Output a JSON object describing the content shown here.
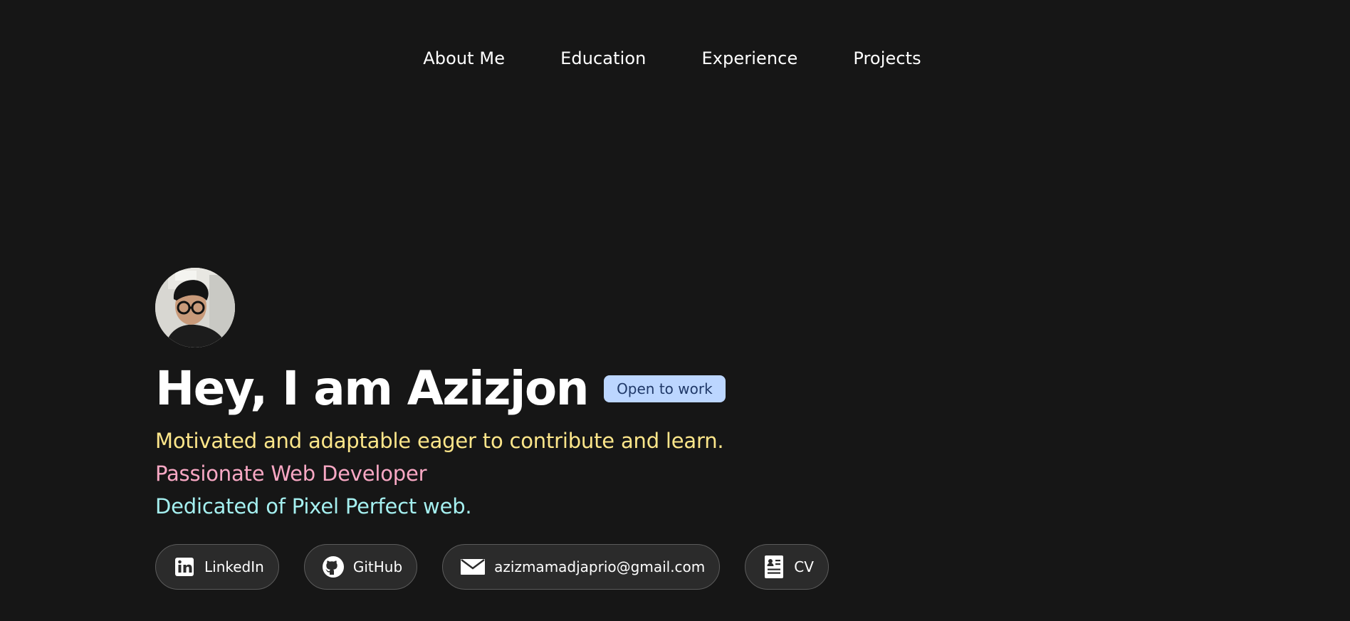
{
  "nav": {
    "items": [
      {
        "label": "About Me"
      },
      {
        "label": "Education"
      },
      {
        "label": "Experience"
      },
      {
        "label": "Projects"
      }
    ]
  },
  "hero": {
    "title": "Hey, I am Azizjon",
    "badge": "Open to work",
    "taglines": [
      "Motivated and adaptable eager to contribute and learn.",
      "Passionate Web Developer",
      "Dedicated of Pixel Perfect web."
    ]
  },
  "links": [
    {
      "label": "LinkedIn",
      "icon": "linkedin-icon"
    },
    {
      "label": "GitHub",
      "icon": "github-icon"
    },
    {
      "label": "azizmamadjaprio@gmail.com",
      "icon": "mail-icon"
    },
    {
      "label": "CV",
      "icon": "document-icon"
    }
  ],
  "colors": {
    "background": "#161616",
    "badge_bg": "#bcd6ff",
    "badge_text": "#1f3868",
    "tagline_1": "#fde68a",
    "tagline_2": "#f9a8c4",
    "tagline_3": "#a5f0f0",
    "pill_bg": "#2b2b2b"
  }
}
